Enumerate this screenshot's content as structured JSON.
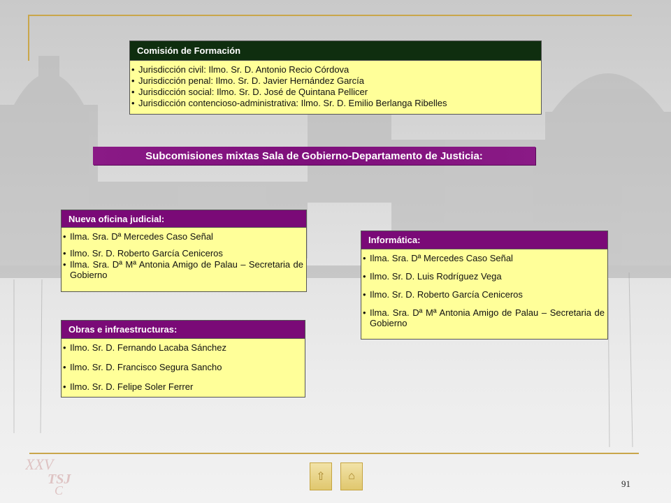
{
  "comision": {
    "title": "Comisión de Formación",
    "items": [
      "Jurisdicción civil:   Ilmo. Sr. D. Antonio Recio Córdova",
      "Jurisdicción penal:  Ilmo. Sr. D. Javier Hernández García",
      "Jurisdicción social: Ilmo. Sr. D. José de Quintana Pellicer",
      "Jurisdicción contencioso-administrativa: Ilmo. Sr. D. Emilio Berlanga Ribelles"
    ]
  },
  "banner": "Subcomisiones mixtas Sala de Gobierno-Departamento de Justicia:",
  "nueva_oficina": {
    "title": "Nueva oficina judicial:",
    "items": [
      "Ilma. Sra. Dª Mercedes Caso Señal",
      "Ilmo. Sr.   D.  Roberto García Ceniceros",
      "Ilma.  Sra.  Dª  Mª  Antonia  Amigo  de  Palau  – Secretaria de Gobierno"
    ]
  },
  "informatica": {
    "title": "Informática:",
    "items": [
      "Ilma. Sra. Dª Mercedes Caso Señal",
      "Ilmo. Sr.  D. Luis Rodríguez Vega",
      "Ilmo. Sr.  D. Roberto García Ceniceros",
      "Ilma.  Sra.  Dª  Mª  Antonia  Amigo  de  Palau  – Secretaria de Gobierno"
    ]
  },
  "obras": {
    "title": "Obras e infraestructuras:",
    "items": [
      "Ilmo. Sr. D. Fernando Lacaba Sánchez",
      "Ilmo. Sr. D. Francisco Segura Sancho",
      "Ilmo. Sr. D. Felipe Soler Ferrer"
    ]
  },
  "logo_text": "XXV TSJ C",
  "page_number": "91",
  "colors": {
    "green_header": "#0f2e0f",
    "purple_header": "#7a0a77",
    "box_fill": "#ffff99",
    "gold_line": "#c9a64a"
  },
  "icons": [
    "up-arrow-icon",
    "home-icon"
  ]
}
